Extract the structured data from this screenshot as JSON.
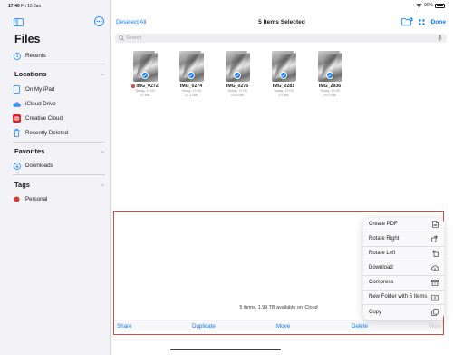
{
  "statusbar": {
    "time": "17:40",
    "date": "Fri 15 Jan",
    "battery": "90%"
  },
  "sidebar": {
    "title": "Files",
    "recents": "Recents",
    "locations_header": "Locations",
    "locations": [
      "On My iPad",
      "iCloud Drive",
      "Creative Cloud",
      "Recently Deleted"
    ],
    "favorites_header": "Favorites",
    "favorites": [
      "Downloads"
    ],
    "tags_header": "Tags",
    "tags": [
      {
        "label": "Personal",
        "color": "#d9382d"
      }
    ]
  },
  "toolbar": {
    "deselect_label": "Deselect All",
    "title": "5 Items Selected",
    "done_label": "Done"
  },
  "search": {
    "placeholder": "Search",
    "value": ""
  },
  "files": [
    {
      "name": "IMG_0272",
      "date": "Today, 17:09",
      "size": "10 MB",
      "tag_color": "#e0483e"
    },
    {
      "name": "IMG_0274",
      "date": "Today, 17:09",
      "size": "12.1 MB"
    },
    {
      "name": "IMG_0276",
      "date": "Today, 17:09",
      "size": "13.6 MB"
    },
    {
      "name": "IMG_0281",
      "date": "Today, 17:09",
      "size": "10 MB"
    },
    {
      "name": "IMG_2936",
      "date": "Today, 17:09",
      "size": "29.5 MB"
    }
  ],
  "storage_text": "5 items, 1.99 TB available on iCloud",
  "bottom_actions": {
    "share": "Share",
    "duplicate": "Duplicate",
    "move": "Move",
    "delete": "Delete",
    "more": "More"
  },
  "menu": [
    {
      "label": "Create PDF",
      "icon": "document-icon"
    },
    {
      "label": "Rotate Right",
      "icon": "rotate-right-icon"
    },
    {
      "label": "Rotate Left",
      "icon": "rotate-left-icon"
    },
    {
      "label": "Download",
      "icon": "cloud-download-icon"
    },
    {
      "label": "Compress",
      "icon": "archive-icon"
    },
    {
      "label": "New Folder with 5 Items",
      "icon": "folder-plus-icon"
    },
    {
      "label": "Copy",
      "icon": "copy-icon"
    }
  ],
  "colors": {
    "accent": "#0a7bff",
    "selection_outline": "#d94b3a"
  }
}
